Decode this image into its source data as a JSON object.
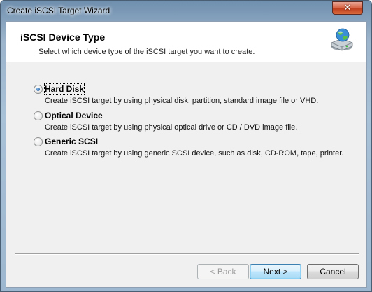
{
  "window": {
    "title": "Create iSCSI Target Wizard",
    "close_glyph": "✕"
  },
  "header": {
    "title": "iSCSI Device Type",
    "subtitle": "Select which device type of the iSCSI target you want to create.",
    "icon": "network-disk-icon"
  },
  "options": [
    {
      "label": "Hard Disk",
      "description": "Create iSCSI target by using physical disk, partition, standard image file or VHD.",
      "checked": true
    },
    {
      "label": "Optical Device",
      "description": "Create iSCSI target by using physical optical drive or CD / DVD image file.",
      "checked": false
    },
    {
      "label": "Generic SCSI",
      "description": "Create iSCSI target by using generic SCSI device, such as disk, CD-ROM, tape, printer.",
      "checked": false
    }
  ],
  "buttons": {
    "back": "< Back",
    "next": "Next >",
    "cancel": "Cancel"
  },
  "colors": {
    "accent": "#3c7fb1",
    "radio_dot": "#2b64a8",
    "title_bar": "#9db5cc"
  }
}
